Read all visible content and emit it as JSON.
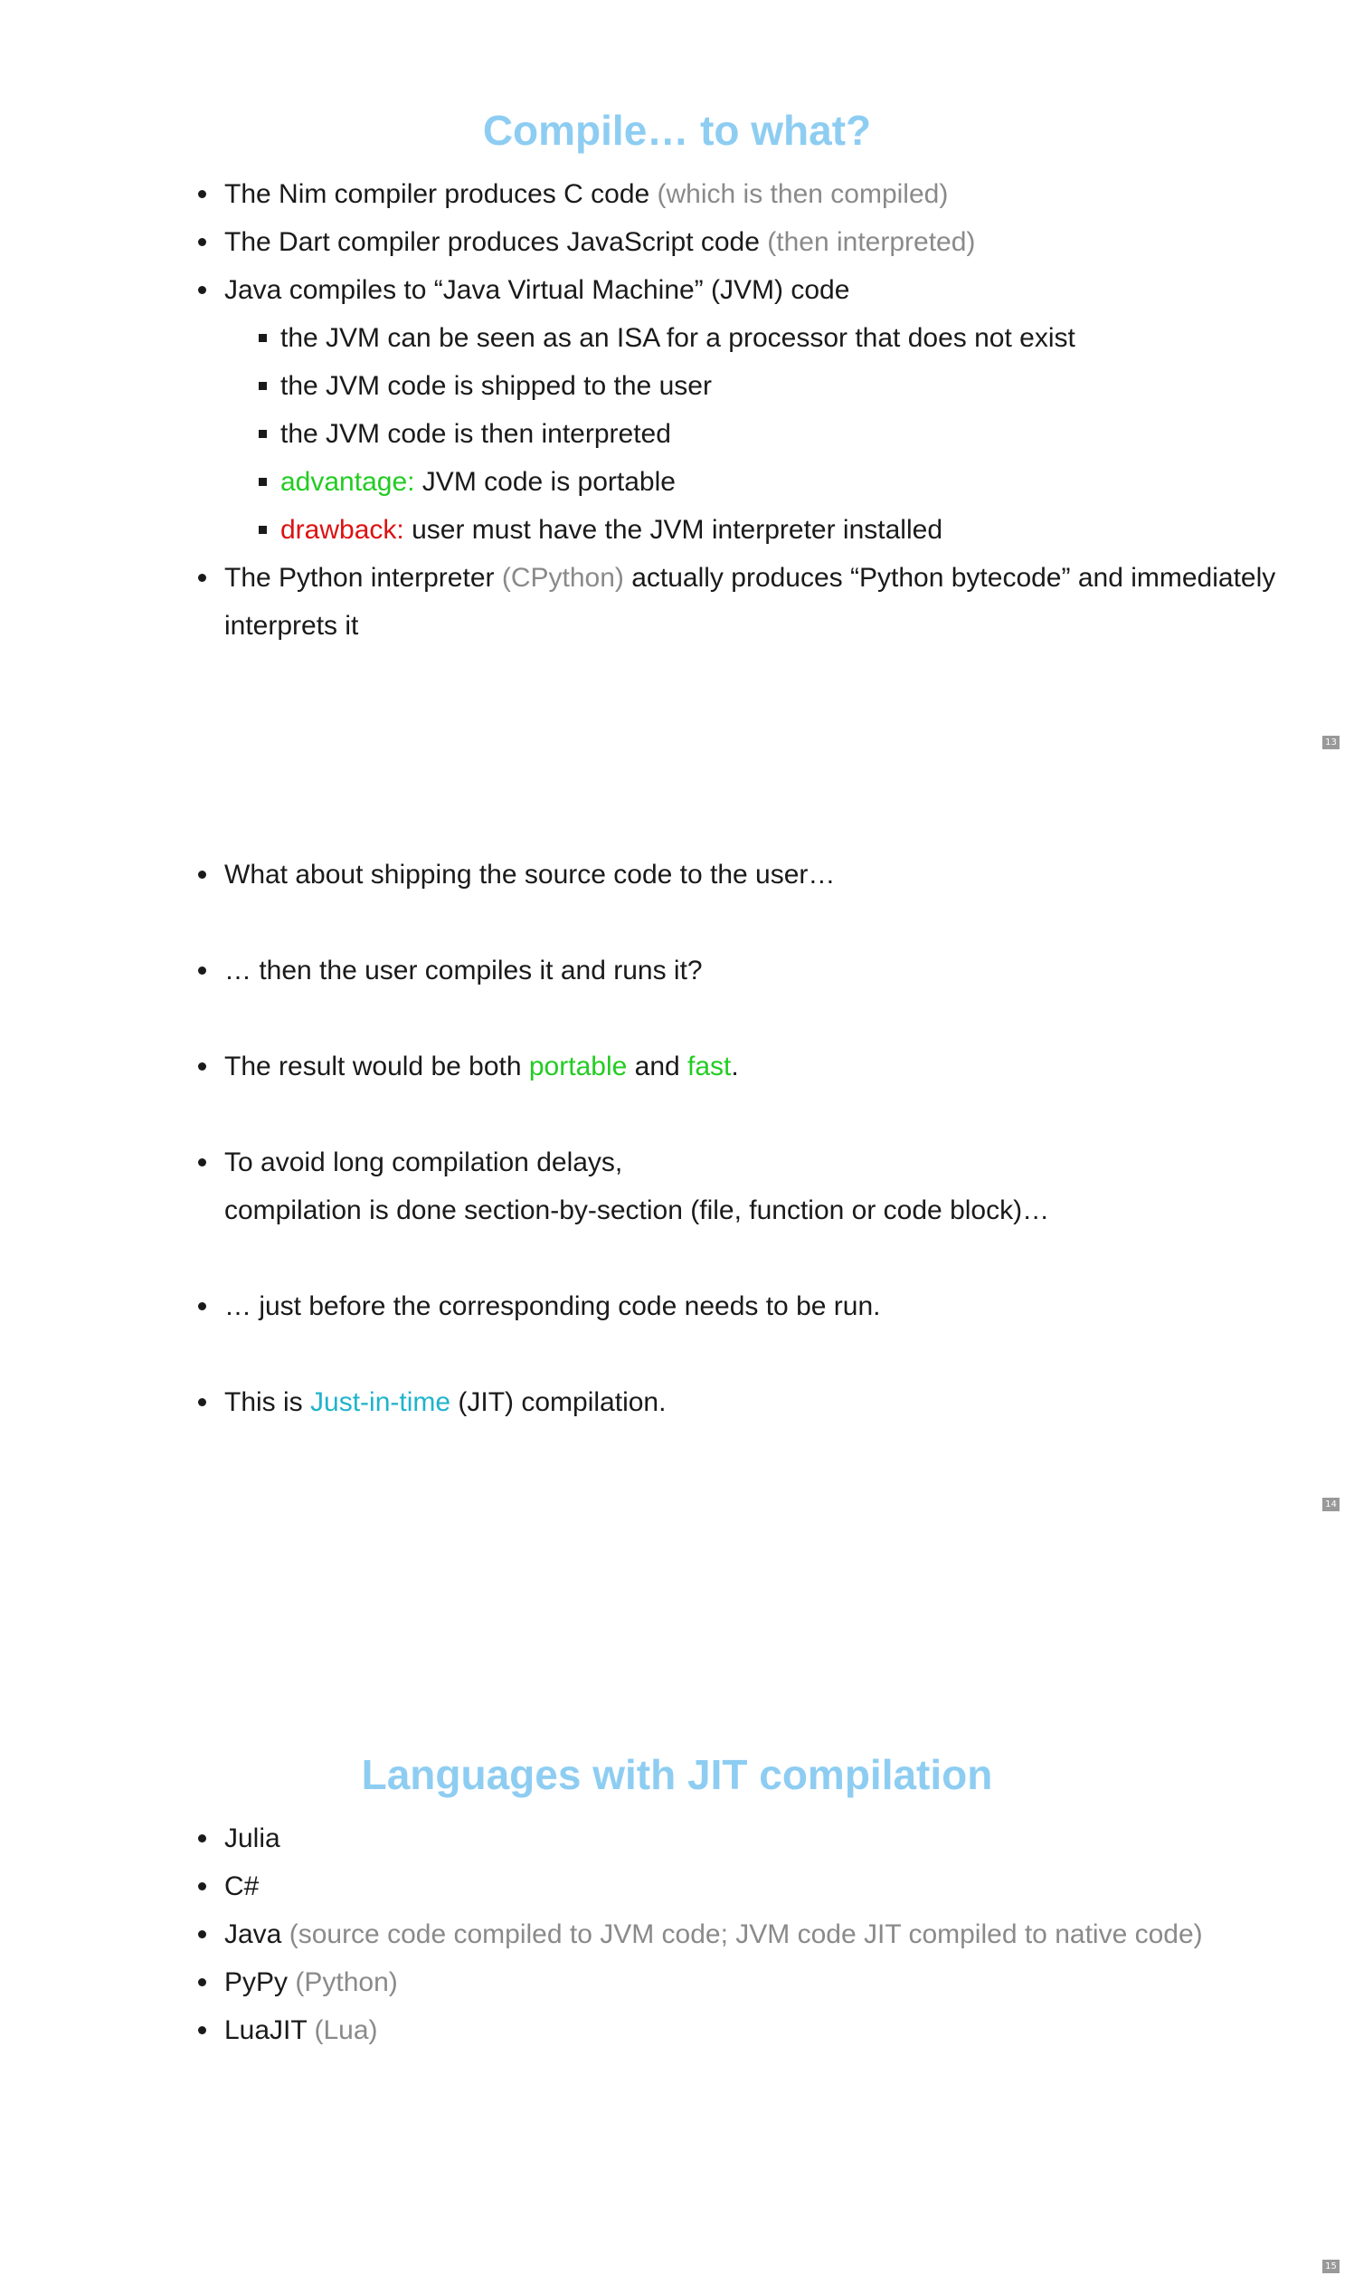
{
  "slides": [
    {
      "title": "Compile… to what?",
      "page": "13",
      "items": {
        "nim": {
          "text": "The Nim compiler produces C code ",
          "note": "(which is then compiled)"
        },
        "dart": {
          "text": "The Dart compiler produces JavaScript code ",
          "note": "(then interpreted)"
        },
        "java": {
          "text": "Java compiles to “Java Virtual Machine” (JVM) code"
        },
        "java_sub": [
          "the JVM can be seen as an ISA for a processor that does not exist",
          "the JVM code is shipped to the user",
          "the JVM code is then interpreted"
        ],
        "advantage": {
          "label": "advantage:",
          "text": " JVM code is portable"
        },
        "drawback": {
          "label": "drawback:",
          "text": " user must have the JVM interpreter installed"
        },
        "python": {
          "pre": "The Python interpreter ",
          "note": "(CPython)",
          "post": " actually produces “Python bytecode” and immediately interprets it"
        }
      }
    },
    {
      "page": "14",
      "items": {
        "b1": "What about shipping the source code to the user…",
        "b2": "… then the user compiles it and runs it?",
        "b3": {
          "pre": "The result would be both ",
          "portable": "portable",
          "mid": " and ",
          "fast": "fast",
          "post": "."
        },
        "b4": {
          "line1": "To avoid long compilation delays,",
          "line2": "compilation is done section-by-section (file, function or code block)…"
        },
        "b5": "… just before the corresponding code needs to be run.",
        "b6": {
          "pre": "This is ",
          "link": "Just-in-time",
          "post": " (JIT) compilation."
        }
      }
    },
    {
      "title": "Languages with JIT compilation",
      "page": "15",
      "items": [
        {
          "name": "Julia",
          "note": ""
        },
        {
          "name": "C#",
          "note": ""
        },
        {
          "name": "Java",
          "note": " (source code compiled to JVM code; JVM code JIT compiled to native code)"
        },
        {
          "name": "PyPy",
          "note": " (Python)"
        },
        {
          "name": "LuaJIT",
          "note": " (Lua)"
        }
      ]
    }
  ],
  "colors": {
    "title": "#8ecdf2",
    "note_gray": "#8a8a8a",
    "advantage_green": "#22cc22",
    "drawback_red": "#dd1111",
    "jit_teal": "#1fb3cc",
    "page_badge": "#999999"
  }
}
